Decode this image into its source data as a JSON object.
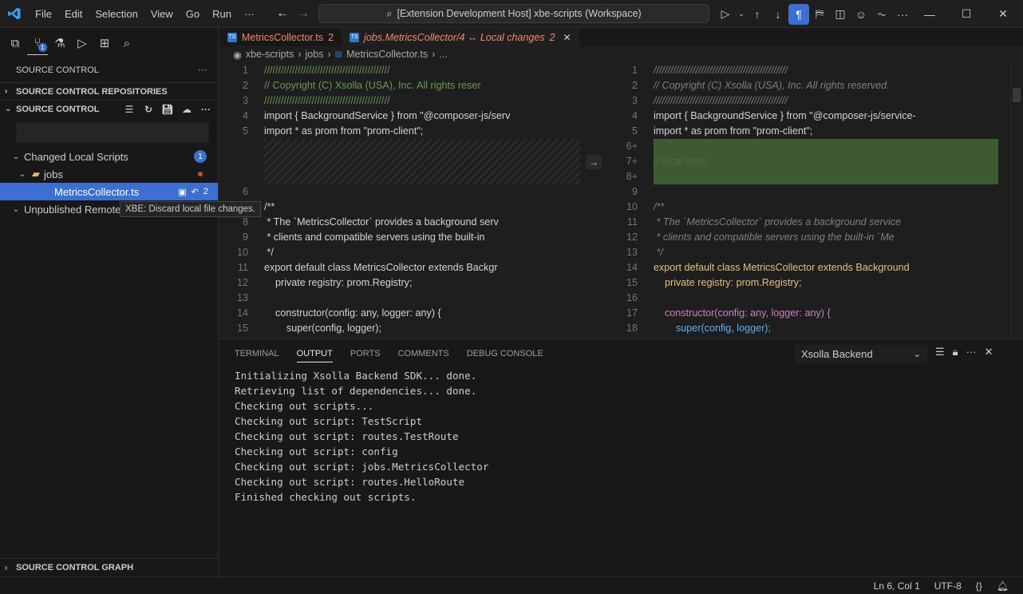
{
  "menu": [
    "File",
    "Edit",
    "Selection",
    "View",
    "Go",
    "Run",
    "···"
  ],
  "search": {
    "text": "[Extension Development Host] xbe-scripts (Workspace)"
  },
  "sidebar": {
    "title": "SOURCE CONTROL",
    "repositories_header": "SOURCE CONTROL REPOSITORIES",
    "scm_header": "SOURCE CONTROL",
    "changed_group": "Changed Local Scripts",
    "changed_count": "1",
    "folder": "jobs",
    "file": "MetricsCollector.ts",
    "file_count": "2",
    "unpublished_group": "Unpublished Remote",
    "tooltip": "XBE: Discard local file changes.",
    "graph_header": "SOURCE CONTROL GRAPH",
    "activity_badge": "1"
  },
  "tabs": [
    {
      "label": "MetricsCollector.ts",
      "count": "2"
    },
    {
      "label": "jobs.MetricsCollector/4 ↔ Local changes",
      "count": "2"
    }
  ],
  "breadcrumb": [
    "xbe-scripts",
    "jobs",
    "MetricsCollector.ts",
    "..."
  ],
  "left_pane": {
    "line_numbers": [
      "1",
      "2",
      "3",
      "4",
      "5",
      "",
      "",
      "",
      "6",
      "7",
      "8",
      "9",
      "10",
      "11",
      "12",
      "13",
      "14",
      "15"
    ],
    "lines": [
      "/////////////////////////////////////////////",
      "// Copyright (C) Xsolla (USA), Inc. All rights reser",
      "/////////////////////////////////////////////",
      "import { BackgroundService } from \"@composer-js/serv",
      "import * as prom from \"prom-client\";",
      "",
      "",
      "",
      "",
      "/**",
      " * The `MetricsCollector` provides a background serv",
      " * clients and compatible servers using the built-in",
      " */",
      "export default class MetricsCollector extends Backgr",
      "    private registry: prom.Registry;",
      "",
      "    constructor(config: any, logger: any) {",
      "        super(config, logger);"
    ]
  },
  "right_pane": {
    "line_numbers": [
      "1",
      "2",
      "3",
      "4",
      "5",
      "6+",
      "7+",
      "8+",
      "9",
      "10",
      "11",
      "12",
      "13",
      "14",
      "15",
      "16",
      "17",
      "18"
    ],
    "lines": [
      "////////////////////////////////////////////////",
      "// Copyright (C) Xsolla (USA), Inc. All rights reserved.",
      "////////////////////////////////////////////////",
      "import { BackgroundService } from \"@composer-js/service-",
      "import * as prom from \"prom-client\";",
      "",
      "// local edits",
      "",
      "",
      "/**",
      " * The `MetricsCollector` provides a background service",
      " * clients and compatible servers using the built-in `Me",
      " */",
      "export default class MetricsCollector extends Background",
      "    private registry: prom.Registry;",
      "",
      "    constructor(config: any, logger: any) {",
      "        super(config, logger);"
    ]
  },
  "panel": {
    "tabs": [
      "TERMINAL",
      "OUTPUT",
      "PORTS",
      "COMMENTS",
      "DEBUG CONSOLE"
    ],
    "channel": "Xsolla Backend",
    "output": [
      "Initializing Xsolla Backend SDK... done.",
      "Retrieving list of dependencies... done.",
      "Checking out scripts...",
      "Checking out script: TestScript",
      "Checking out script: routes.TestRoute",
      "Checking out script: config",
      "Checking out script: jobs.MetricsCollector",
      "Checking out script: routes.HelloRoute",
      "Finished checking out scripts."
    ]
  },
  "status": {
    "position": "Ln 6, Col 1",
    "encoding": "UTF-8"
  },
  "colors": {
    "accent": "#3c6fd1",
    "added_bg": "#3d5a33",
    "error": "#f48771"
  }
}
